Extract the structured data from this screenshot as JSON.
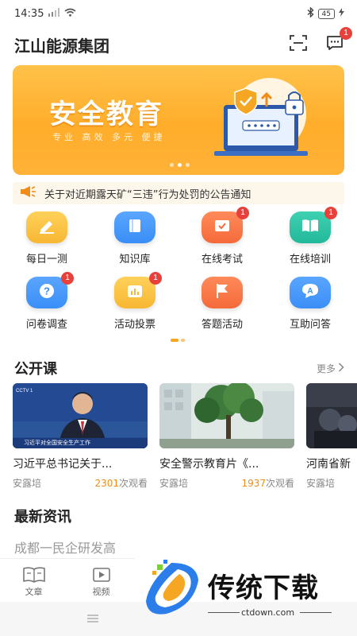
{
  "status_bar": {
    "time": "14:35",
    "signal": "4G",
    "battery": "45"
  },
  "header": {
    "title": "江山能源集团",
    "message_badge": "1"
  },
  "banner": {
    "title": "安全教育",
    "subtitle": "专业 高效 多元 便捷",
    "slide_count": 3,
    "active_slide": 1
  },
  "notice": {
    "text": "关于对近期露天矿“三违”行为处罚的公告通知"
  },
  "features": [
    {
      "label": "每日一测",
      "icon": "pencil-icon",
      "color": "#f7b733",
      "badge": ""
    },
    {
      "label": "知识库",
      "icon": "book-icon",
      "color": "#3a8ef6",
      "badge": ""
    },
    {
      "label": "在线考试",
      "icon": "exam-icon",
      "color": "#f56a3a",
      "badge": "1"
    },
    {
      "label": "在线培训",
      "icon": "open-book-icon",
      "color": "#22b89a",
      "badge": "1"
    },
    {
      "label": "问卷调查",
      "icon": "question-icon",
      "color": "#3a8ef6",
      "badge": "1"
    },
    {
      "label": "活动投票",
      "icon": "vote-icon",
      "color": "#f7b733",
      "badge": "1"
    },
    {
      "label": "答题活动",
      "icon": "flag-icon",
      "color": "#f56a3a",
      "badge": ""
    },
    {
      "label": "互助问答",
      "icon": "answer-icon",
      "color": "#3a8ef6",
      "badge": ""
    }
  ],
  "courses_section": {
    "title": "公开课",
    "more": "更多"
  },
  "courses": [
    {
      "title": "习近平总书记关于...",
      "author": "安露培",
      "views": "2301",
      "views_suffix": "次观看",
      "caption": "习近平对全国安全生产工作",
      "channel": "CCTV 1"
    },
    {
      "title": "安全警示教育片《...",
      "author": "安露培",
      "views": "1937",
      "views_suffix": "次观看"
    },
    {
      "title": "河南省新",
      "author": "安露培",
      "views": "",
      "views_suffix": ""
    }
  ],
  "news_section": {
    "title": "最新资讯",
    "preview": "成都一民企研发高"
  },
  "tabs": [
    {
      "label": "文章",
      "icon": "article-icon"
    },
    {
      "label": "视频",
      "icon": "video-icon"
    }
  ],
  "watermark": {
    "brand": "传统下载",
    "url": "ctdown.com"
  }
}
